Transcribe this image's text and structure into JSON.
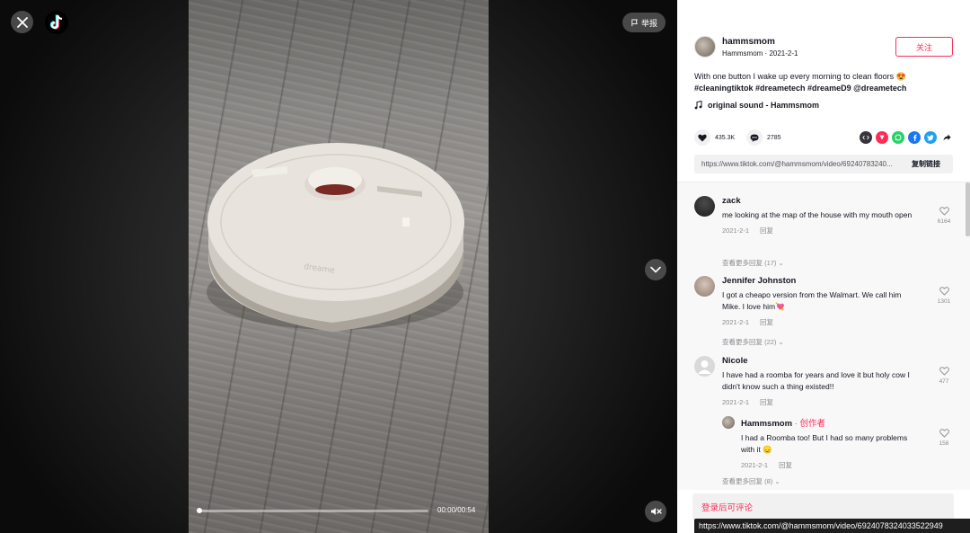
{
  "player": {
    "report_label": "举报",
    "time_label": "00:00/00:54",
    "progress": 0.01
  },
  "author": {
    "username": "hammsmom",
    "nickname": "Hammsmom",
    "date": "2021-2-1",
    "subline": "Hammsmom · 2021-2-1",
    "follow_label": "关注"
  },
  "video": {
    "description": "With one button I wake up every morning to clean floors 😍",
    "hashtags": "#cleaningtiktok #dreametech #dreameD9 @dreametech",
    "music": "original sound - Hammsmom",
    "likes": "435.3K",
    "comments": "2785",
    "share_icons": [
      "embed-icon",
      "pinterest-icon",
      "whatsapp-icon",
      "facebook-icon",
      "twitter-icon",
      "share-arrow-icon"
    ],
    "link": "https://www.tiktok.com/@hammsmom/video/69240783240...",
    "copy_label": "复制链接"
  },
  "comments": [
    {
      "name": "zack",
      "text": "me looking at the map of the house with my mouth open",
      "date": "2021-2-1",
      "reply": "回复",
      "likes": "6164",
      "more": "查看更多回复 (17)"
    },
    {
      "name": "Jennifer Johnston",
      "text": "I got a cheapo version from the Walmart. We call him Mike. I love him💘",
      "date": "2021-2-1",
      "reply": "回复",
      "likes": "1301",
      "more": "查看更多回复 (22)"
    },
    {
      "name": "Nicole",
      "text": "I have had a roomba for years and love it but holy cow I didn't know such a thing existed!!",
      "date": "2021-2-1",
      "reply": "回复",
      "likes": "477"
    }
  ],
  "reply": {
    "name": "Hammsmom",
    "author_tag": "· 创作者",
    "text": "I had a Roomba too! But I had so many problems with it 😞",
    "date": "2021-2-1",
    "reply": "回复",
    "likes": "158",
    "more": "查看更多回复 (8)"
  },
  "login_prompt": "登录后可评论",
  "status_url": "https://www.tiktok.com/@hammsmom/video/6924078324033522949",
  "colors": {
    "accent": "#fe2c55",
    "text": "#161823",
    "muted": "#8a8b91"
  }
}
